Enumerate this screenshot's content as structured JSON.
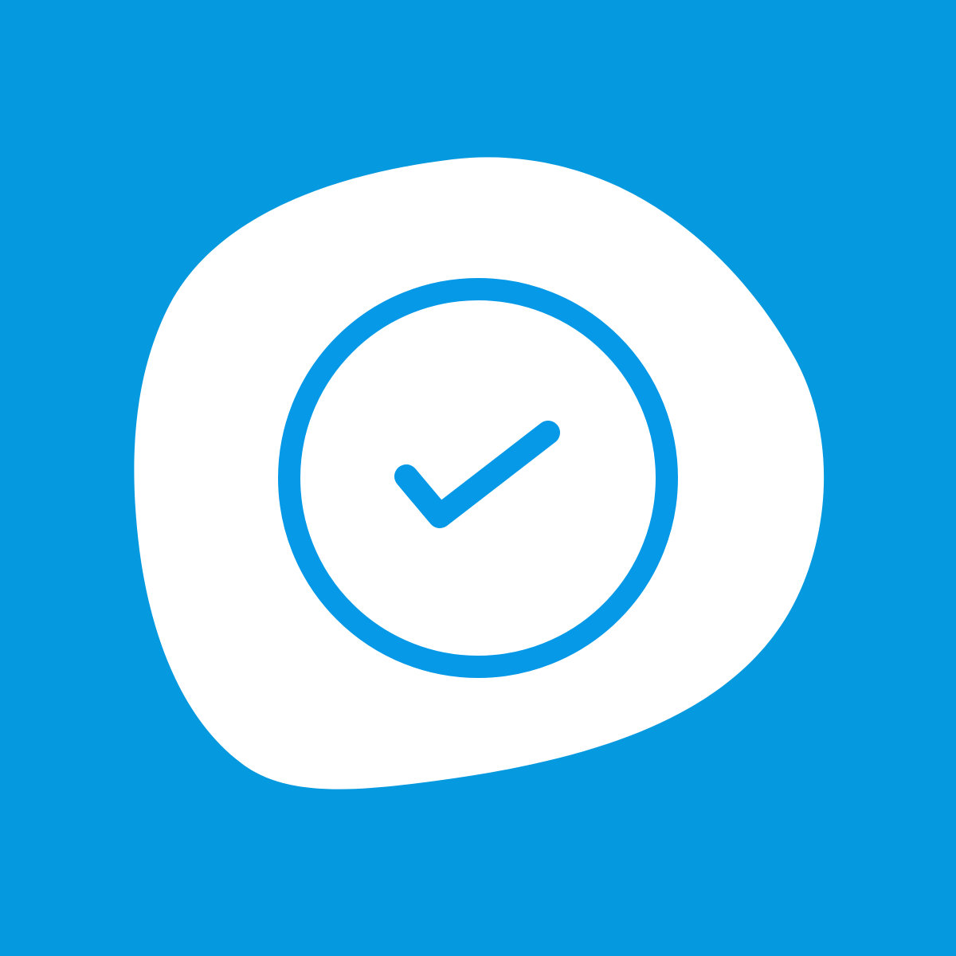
{
  "icon": {
    "name": "check-circle-icon",
    "container": "blob-shape",
    "colors": {
      "background": "#0599df",
      "blob": "#ffffff",
      "ring": "#0599e8",
      "check": "#0599e8"
    }
  }
}
